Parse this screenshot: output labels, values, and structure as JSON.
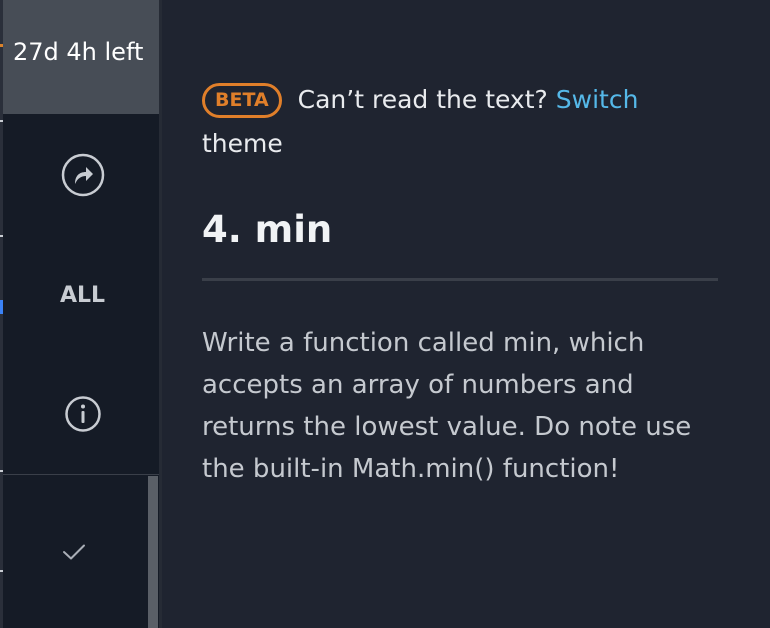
{
  "sidebar": {
    "timer": "27d 4h left",
    "all_label": "ALL",
    "share_icon": "share-arrow-icon",
    "info_icon": "info-icon",
    "check_icon": "checkmark-icon"
  },
  "notice": {
    "badge": "BETA",
    "text": "Can’t read the text?",
    "link_first": "Switch",
    "link_second": "theme"
  },
  "problem": {
    "title": "4. min",
    "description": "Write a function called min, which accepts an array of numbers and returns the lowest value. Do note use the built-in Math.min() function!"
  },
  "colors": {
    "accent_badge": "#e07f2a",
    "link": "#55b8e8",
    "sidebar_bg": "#151b26",
    "main_bg": "#1f2430"
  }
}
